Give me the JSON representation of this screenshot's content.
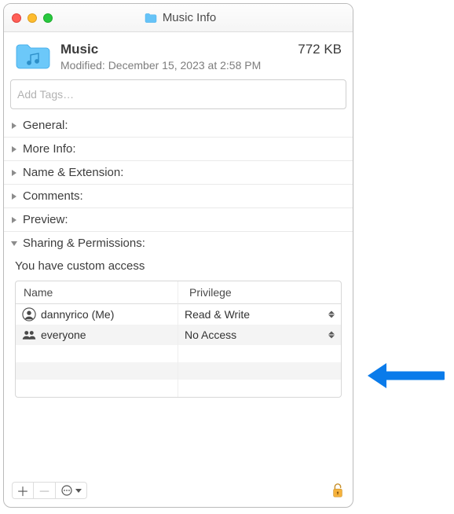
{
  "window_title": "Music Info",
  "folder": {
    "name": "Music",
    "size": "772 KB",
    "modified_label": "Modified: December 15, 2023 at 2:58 PM"
  },
  "tags_placeholder": "Add Tags…",
  "sections": {
    "general": "General:",
    "more_info": "More Info:",
    "name_ext": "Name & Extension:",
    "comments": "Comments:",
    "preview": "Preview:",
    "sharing": "Sharing & Permissions:"
  },
  "sharing": {
    "access_note": "You have custom access",
    "columns": {
      "name": "Name",
      "privilege": "Privilege"
    },
    "rows": [
      {
        "name": "dannyrico (Me)",
        "privilege": "Read & Write"
      },
      {
        "name": "everyone",
        "privilege": "No Access"
      }
    ]
  }
}
